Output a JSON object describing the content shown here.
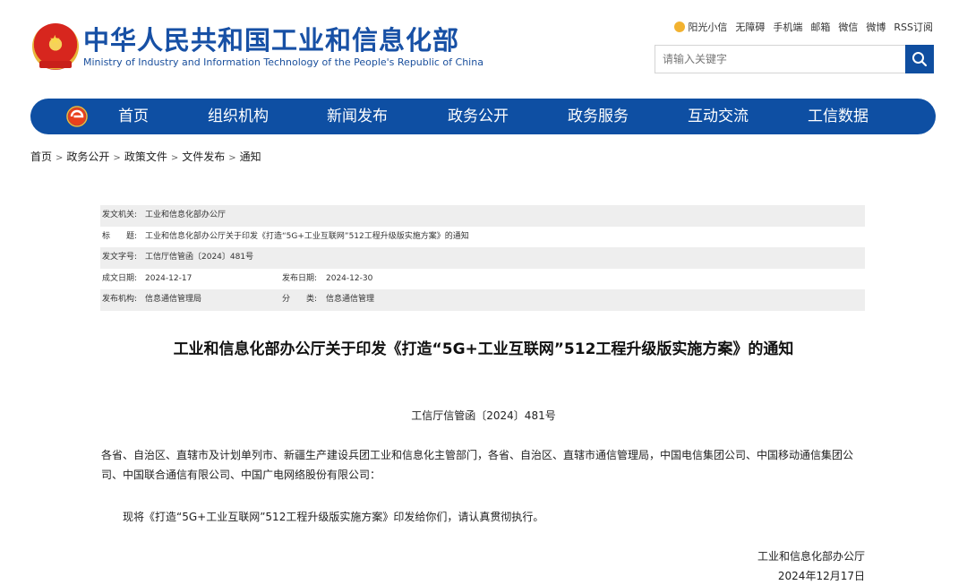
{
  "header": {
    "title": "中华人民共和国工业和信息化部",
    "subtitle": "Ministry of Industry and Information Technology of the People's Republic of China",
    "toplinks": [
      "阳光小信",
      "无障碍",
      "手机端",
      "邮箱",
      "微信",
      "微博",
      "RSS订阅"
    ],
    "search": {
      "placeholder": "请输入关键字"
    }
  },
  "nav": {
    "items": [
      "首页",
      "组织机构",
      "新闻发布",
      "政务公开",
      "政务服务",
      "互动交流",
      "工信数据"
    ]
  },
  "breadcrumb": [
    "首页",
    "政务公开",
    "政策文件",
    "文件发布",
    "通知"
  ],
  "info": {
    "issuer_label": "发文机关:",
    "issuer": "工业和信息化部办公厅",
    "title_label": "标　　题:",
    "title": "工业和信息化部办公厅关于印发《打造“5G+工业互联网”512工程升级版实施方案》的通知",
    "docno_label": "发文字号:",
    "docno": "工信厅信管函〔2024〕481号",
    "written_label": "成文日期:",
    "written": "2024-12-17",
    "published_label": "发布日期:",
    "published": "2024-12-30",
    "org_label": "发布机构:",
    "org": "信息通信管理局",
    "category_label": "分　　类:",
    "category": "信息通信管理"
  },
  "article": {
    "title": "工业和信息化部办公厅关于印发《打造“5G+工业互联网”512工程升级版实施方案》的通知",
    "doc_number": "工信厅信管函〔2024〕481号",
    "addressees": "各省、自治区、直辖市及计划单列市、新疆生产建设兵团工业和信息化主管部门，各省、自治区、直辖市通信管理局，中国电信集团公司、中国移动通信集团公司、中国联合通信有限公司、中国广电网络股份有限公司：",
    "body": "现将《打造“5G+工业互联网”512工程升级版实施方案》印发给你们，请认真贯彻执行。",
    "signer": "工业和信息化部办公厅",
    "date": "2024年12月17日"
  },
  "colors": {
    "brand_blue": "#0e4fa3",
    "title_blue": "#1750a5"
  }
}
